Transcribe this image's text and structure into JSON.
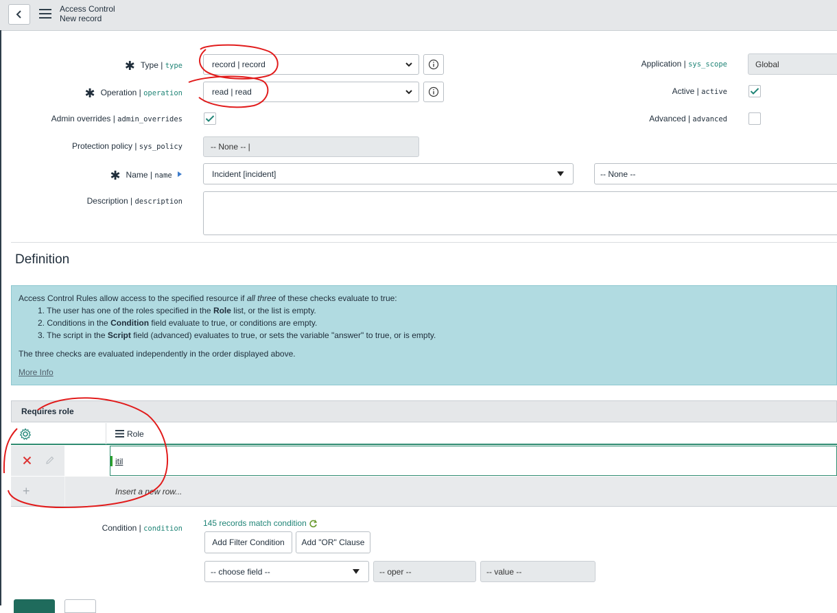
{
  "header": {
    "title": "Access Control",
    "subtitle": "New record"
  },
  "form": {
    "type": {
      "label": "Type",
      "field": "type",
      "value": "record | record"
    },
    "operation": {
      "label": "Operation",
      "field": "operation",
      "value": "read | read"
    },
    "admin_overrides": {
      "label": "Admin overrides",
      "field": "admin_overrides",
      "checked": true
    },
    "protection_policy": {
      "label": "Protection policy",
      "field": "sys_policy",
      "value": "-- None -- |"
    },
    "name": {
      "label": "Name",
      "field": "name",
      "value": "Incident [incident]",
      "secondary_value": "-- None --"
    },
    "description": {
      "label": "Description",
      "field": "description",
      "value": ""
    },
    "application": {
      "label": "Application",
      "field": "sys_scope",
      "value": "Global"
    },
    "active": {
      "label": "Active",
      "field": "active",
      "checked": true
    },
    "advanced": {
      "label": "Advanced",
      "field": "advanced",
      "checked": false
    }
  },
  "definition": {
    "title": "Definition",
    "intro_pre": "Access Control Rules allow access to the specified resource if ",
    "intro_em": "all three",
    "intro_post": " of these checks evaluate to true:",
    "items": [
      {
        "pre": "1. The user has one of the roles specified in the ",
        "bold": "Role",
        "post": " list, or the list is empty."
      },
      {
        "pre": "2. Conditions in the ",
        "bold": "Condition",
        "post": " field evaluate to true, or conditions are empty."
      },
      {
        "pre": "3. The script in the ",
        "bold": "Script",
        "post": " field (advanced) evaluates to true, or sets the variable \"answer\" to true, or is empty."
      }
    ],
    "note": "The three checks are evaluated independently in the order displayed above.",
    "more_info": "More Info"
  },
  "requires_role": {
    "title": "Requires role",
    "column": "Role",
    "rows": [
      {
        "role": "itil"
      }
    ],
    "insert_placeholder": "Insert a new row..."
  },
  "condition": {
    "label": "Condition",
    "field": "condition",
    "match_text": "145 records match condition",
    "add_filter": "Add Filter Condition",
    "add_or": "Add \"OR\" Clause",
    "choose_field": "-- choose field --",
    "oper": "-- oper --",
    "value": "-- value --"
  },
  "colors": {
    "teal": "#1f8476",
    "info_bg": "#b1dbe1",
    "delete_red": "#d33",
    "annotation_red": "#e11b1b"
  }
}
